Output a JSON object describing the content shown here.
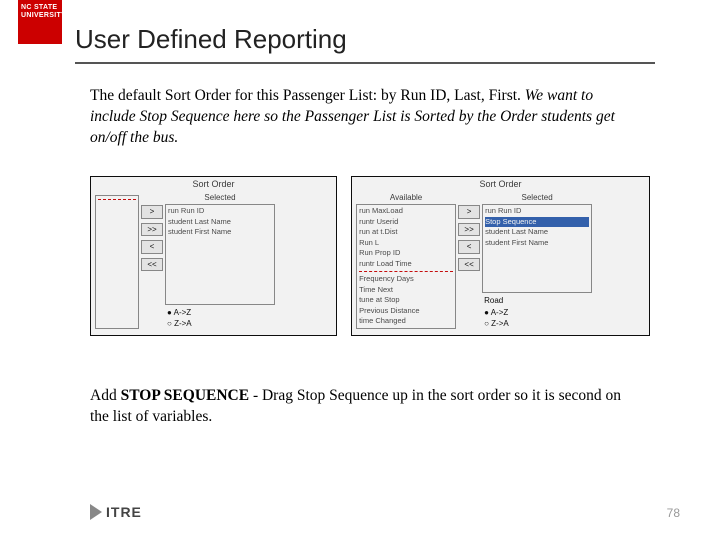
{
  "brand": {
    "line1": "NC STATE",
    "line2": "UNIVERSITY"
  },
  "title": "User Defined Reporting",
  "intro": {
    "plain": "The default Sort Order for this Passenger List: by Run ID, Last, First. ",
    "italic": "We want to include Stop Sequence here so the Passenger List is Sorted by the Order students get on/off the bus."
  },
  "panel_left": {
    "title": "Sort Order",
    "available_header": "",
    "selected_header": "Selected",
    "available": [],
    "selected": [
      "run Run ID",
      "student Last Name",
      "student First Name"
    ],
    "buttons": [
      ">",
      ">>",
      "<",
      "<<"
    ],
    "radios": [
      "A->Z",
      "Z->A"
    ]
  },
  "panel_right": {
    "title": "Sort Order",
    "available_header": "Available",
    "selected_header": "Selected",
    "available": [
      "run MaxLoad",
      "runtr Userid",
      "run at t.Dist",
      "Run L",
      "Run Prop ID",
      "runtr Load Time",
      "Frequency Days",
      "Time Next",
      "tune at Stop",
      "Previous Distance",
      "time Changed"
    ],
    "selected": [
      "run Run ID",
      "Stop Sequence",
      "student Last Name",
      "student First Name"
    ],
    "selected_highlight_index": 1,
    "buttons": [
      ">",
      ">>",
      "<",
      "<<"
    ],
    "radios_header": "Road",
    "radios": [
      "A->Z",
      "Z->A"
    ]
  },
  "instruction": {
    "lead": "Add ",
    "bold": "STOP SEQUENCE",
    "rest": " - Drag Stop Sequence up in the sort order so it is second on the list of variables."
  },
  "footer_logo": "ITRE",
  "page_number": "78"
}
